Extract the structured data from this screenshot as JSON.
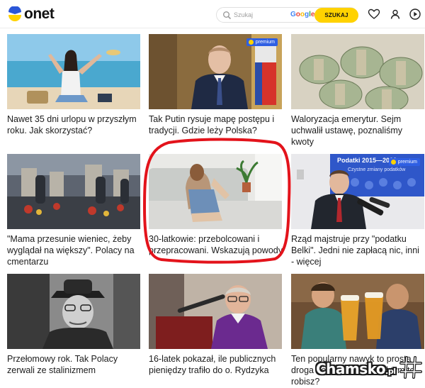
{
  "header": {
    "logo_text": "onet",
    "search_placeholder": "Szukaj",
    "search_engine": "Google",
    "search_button": "SZUKAJ",
    "icons": [
      "heart-icon",
      "user-icon",
      "play-icon"
    ]
  },
  "badge_label": "premium",
  "colors": {
    "accent": "#ffd200",
    "badge": "#2f5fe3",
    "annotation": "#e3131b"
  },
  "articles": [
    {
      "title": "Nawet 35 dni urlopu w przyszłym roku. Jak skorzystać?",
      "premium": false
    },
    {
      "title": "Tak Putin rysuje mapę postępu i tradycji. Gdzie leży Polska?",
      "premium": true
    },
    {
      "title": "Waloryzacja emerytur. Sejm uchwalił ustawę, poznaliśmy kwoty",
      "premium": false
    },
    {
      "title": "\"Mama przesunie wieniec, żeby wyglądał na większy\". Polacy na cmentarzu",
      "premium": false
    },
    {
      "title": "30-latkowie: przebolcowani i przepracowani. Wskazują powody",
      "premium": false
    },
    {
      "title": "Rząd majstruje przy \"podatku Belki\". Jedni nie zapłacą nic, inni - więcej",
      "premium": true
    },
    {
      "title": "Przełomowy rok. Tak Polacy zerwali ze stalinizmem",
      "premium": false
    },
    {
      "title": "16-latek pokazał, ile publicznych pieniędzy trafiło do o. Rydzyka",
      "premium": false
    },
    {
      "title": "Ten popularny nawyk to prosta droga do... Jak się przed tym to robisz?",
      "premium": false
    }
  ],
  "image_overlay_text": {
    "podatki": "Podatki 2015—2023",
    "podatki_sub": "Czystne zmiany podatków"
  },
  "watermark": {
    "main": "Chamsko",
    "suffix": ".pl"
  }
}
